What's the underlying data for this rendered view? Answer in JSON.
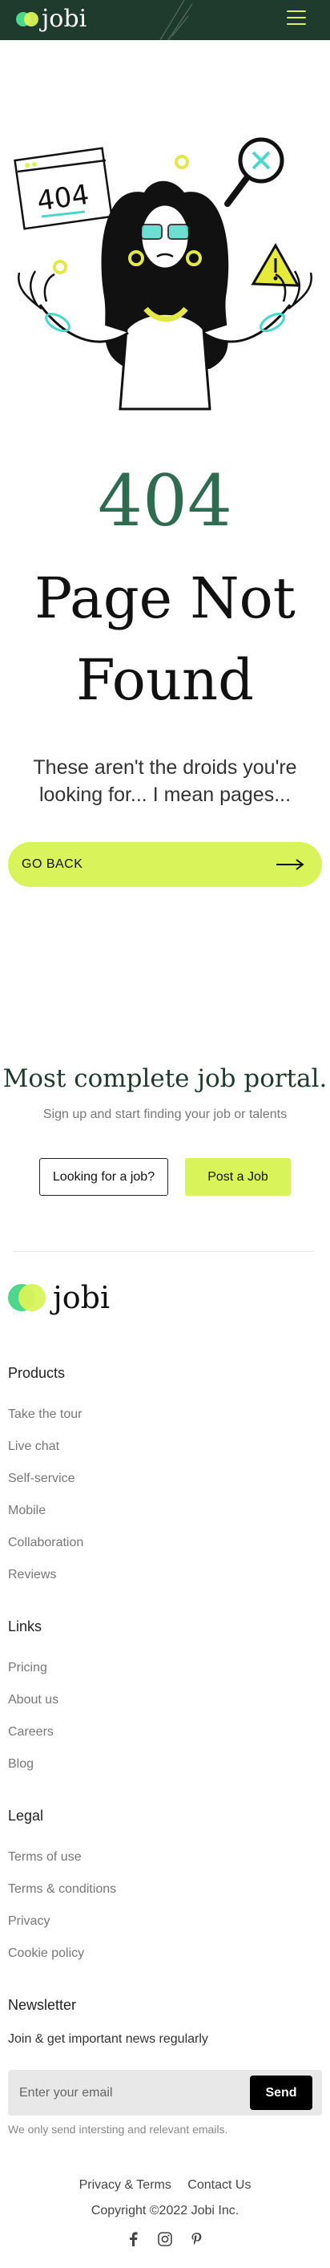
{
  "header": {
    "brand": "jobi",
    "menu_icon": "hamburger-menu-icon",
    "accent": "#d9f35a",
    "bg": "#1f3b2e"
  },
  "error": {
    "code": "404",
    "title_line1": "Page Not",
    "title_line2": "Found",
    "subtitle": "These aren't the droids you're looking for... I mean pages...",
    "go_back_label": "GO BACK",
    "arrow_icon": "arrow-right-icon",
    "illustration_sign": "404"
  },
  "cta": {
    "title": "Most complete job portal.",
    "subtitle": "Sign up and start finding your job or talents",
    "btn_looking": "Looking for a job?",
    "btn_post": "Post a Job"
  },
  "footer": {
    "brand": "jobi",
    "products": {
      "title": "Products",
      "links": [
        "Take the tour",
        "Live chat",
        "Self-service",
        "Mobile",
        "Collaboration",
        "Reviews"
      ]
    },
    "links": {
      "title": "Links",
      "links": [
        "Pricing",
        "About us",
        "Careers",
        "Blog"
      ]
    },
    "legal": {
      "title": "Legal",
      "links": [
        "Terms of use",
        "Terms & conditions",
        "Privacy",
        "Cookie policy"
      ]
    },
    "newsletter": {
      "title": "Newsletter",
      "text": "Join & get important news regularly",
      "placeholder": "Enter your email",
      "send": "Send",
      "note": "We only send intersting and relevant emails."
    },
    "bottom": {
      "privacy_terms": "Privacy & Terms",
      "contact": "Contact Us",
      "copyright": "Copyright ©2022 Jobi Inc."
    },
    "socials": [
      "facebook-icon",
      "instagram-icon",
      "pinterest-icon"
    ]
  }
}
